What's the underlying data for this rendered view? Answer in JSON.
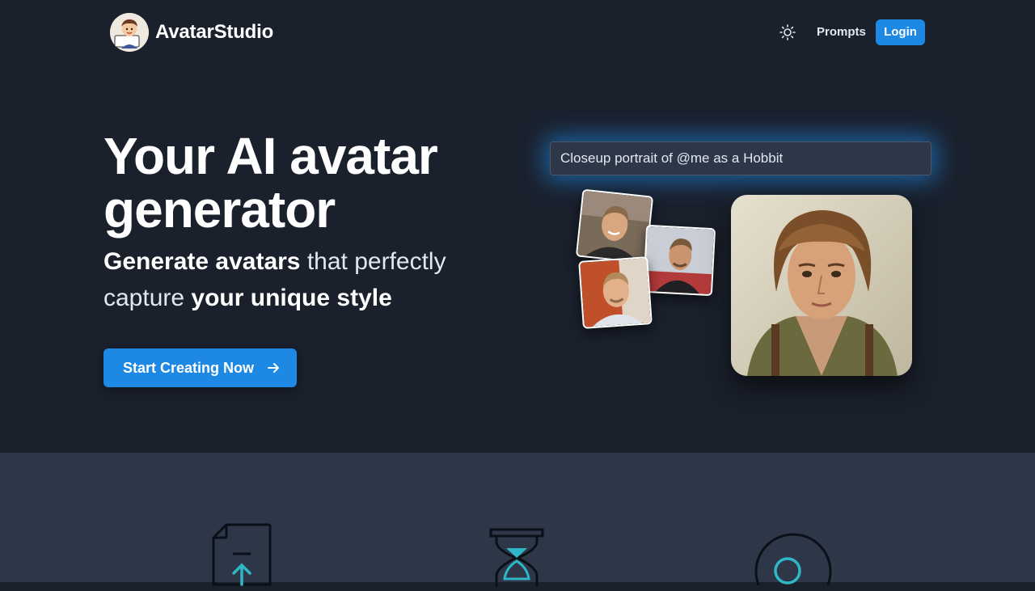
{
  "header": {
    "brand": "AvatarStudio",
    "theme_toggle_icon": "sun-icon",
    "nav_prompts": "Prompts",
    "login_label": "Login"
  },
  "hero": {
    "title": "Your AI avatar generator",
    "subtitle_parts": [
      "Generate avatars",
      " that perfectly capture ",
      "your unique style"
    ],
    "cta_label": "Start Creating Now",
    "cta_icon": "arrow-right-icon",
    "prompt_value": "Closeup portrait of @me as a Hobbit"
  },
  "features": {
    "icons": [
      "file-upload-icon",
      "hourglass-icon",
      "circle-icon"
    ]
  },
  "colors": {
    "background": "#1a202c",
    "section_background": "#2d3748",
    "accent": "#1e88e5",
    "feature_icon_accent": "#2fb7c8"
  }
}
